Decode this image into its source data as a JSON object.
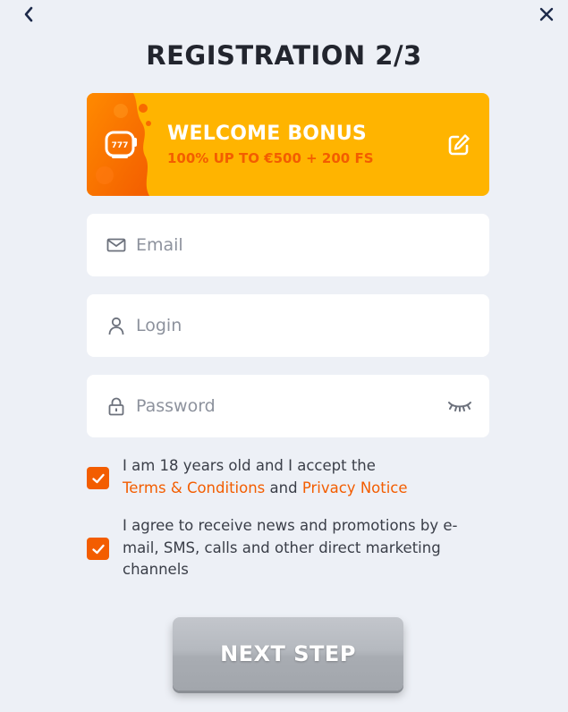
{
  "header": {
    "title": "REGISTRATION 2/3"
  },
  "bonus": {
    "title": "WELCOME BONUS",
    "subtitle": "100% UP TO €500 + 200 FS",
    "slot_icon": "slot-machine-777-icon",
    "edit_icon": "edit-icon"
  },
  "form": {
    "email": {
      "value": "",
      "placeholder": "Email",
      "icon": "mail-icon"
    },
    "login": {
      "value": "",
      "placeholder": "Login",
      "icon": "user-icon"
    },
    "password": {
      "value": "",
      "placeholder": "Password",
      "icon": "lock-icon",
      "toggle_icon": "eye-closed-icon"
    }
  },
  "consents": {
    "age": {
      "checked": true,
      "text_before": "I am 18 years old and I accept the",
      "terms_link": "Terms & Conditions",
      "and_text": "and",
      "privacy_link": "Privacy Notice"
    },
    "marketing": {
      "checked": true,
      "text": "I agree to receive news and promotions by e-mail, SMS, calls and other direct marketing channels"
    }
  },
  "actions": {
    "next_label": "NEXT STEP"
  },
  "colors": {
    "accent": "#f35d00",
    "bonus_bg": "#ffb400",
    "page_bg": "#edf0f6",
    "button_bg": "#b1b5bb"
  }
}
